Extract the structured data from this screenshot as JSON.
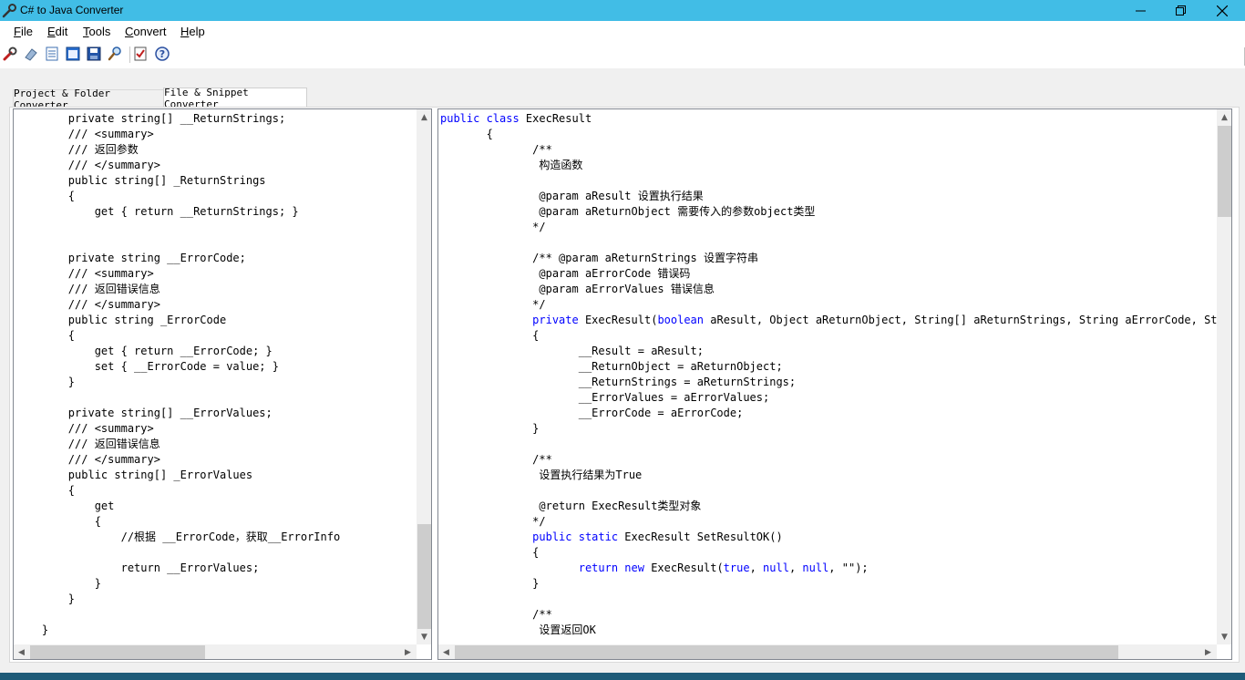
{
  "window": {
    "title": "C# to Java Converter"
  },
  "menu": [
    {
      "key": "F",
      "rest": "ile"
    },
    {
      "key": "E",
      "rest": "dit"
    },
    {
      "key": "T",
      "rest": "ools"
    },
    {
      "key": "C",
      "rest": "onvert"
    },
    {
      "key": "H",
      "rest": "elp"
    }
  ],
  "toolbar": {
    "icons": [
      "wrench-icon",
      "eraser-icon",
      "open-file-icon",
      "window-icon",
      "save-icon",
      "find-icon",
      "checklist-icon",
      "help-icon"
    ]
  },
  "tabs": [
    {
      "label": "Project & Folder Converter",
      "active": false
    },
    {
      "label": "File & Snippet Converter",
      "active": true
    }
  ],
  "left_code": [
    "        private string[] __ReturnStrings;",
    "        /// <summary>",
    "        /// 返回参数",
    "        /// </summary>",
    "        public string[] _ReturnStrings",
    "        {",
    "            get { return __ReturnStrings; }",
    "",
    "",
    "        private string __ErrorCode;",
    "        /// <summary>",
    "        /// 返回错误信息",
    "        /// </summary>",
    "        public string _ErrorCode",
    "        {",
    "            get { return __ErrorCode; }",
    "            set { __ErrorCode = value; }",
    "        }",
    "",
    "        private string[] __ErrorValues;",
    "        /// <summary>",
    "        /// 返回错误信息",
    "        /// </summary>",
    "        public string[] _ErrorValues",
    "        {",
    "            get",
    "            {",
    "                //根据 __ErrorCode，获取__ErrorInfo",
    "",
    "                return __ErrorValues;",
    "            }",
    "        }",
    "",
    "    }"
  ],
  "right_code": [
    [
      {
        "t": "public class",
        "k": true
      },
      {
        "t": " ExecResult"
      }
    ],
    [
      {
        "t": "       {"
      }
    ],
    [
      {
        "t": "              /**"
      }
    ],
    [
      {
        "t": "               构造函数"
      }
    ],
    [
      {
        "t": ""
      }
    ],
    [
      {
        "t": "               @param aResult 设置执行结果"
      }
    ],
    [
      {
        "t": "               @param aReturnObject 需要传入的参数object类型"
      }
    ],
    [
      {
        "t": "              */"
      }
    ],
    [
      {
        "t": ""
      }
    ],
    [
      {
        "t": "              /** @param aReturnStrings 设置字符串"
      }
    ],
    [
      {
        "t": "               @param aErrorCode 错误码"
      }
    ],
    [
      {
        "t": "               @param aErrorValues 错误信息"
      }
    ],
    [
      {
        "t": "              */"
      }
    ],
    [
      {
        "t": "              "
      },
      {
        "t": "private",
        "k": true
      },
      {
        "t": " ExecResult("
      },
      {
        "t": "boolean",
        "k": true
      },
      {
        "t": " aResult, Object aReturnObject, String[] aReturnStrings, String aErrorCode, String"
      }
    ],
    [
      {
        "t": "              {"
      }
    ],
    [
      {
        "t": "                     __Result = aResult;"
      }
    ],
    [
      {
        "t": "                     __ReturnObject = aReturnObject;"
      }
    ],
    [
      {
        "t": "                     __ReturnStrings = aReturnStrings;"
      }
    ],
    [
      {
        "t": "                     __ErrorValues = aErrorValues;"
      }
    ],
    [
      {
        "t": "                     __ErrorCode = aErrorCode;"
      }
    ],
    [
      {
        "t": "              }"
      }
    ],
    [
      {
        "t": ""
      }
    ],
    [
      {
        "t": "              /**"
      }
    ],
    [
      {
        "t": "               设置执行结果为True"
      }
    ],
    [
      {
        "t": ""
      }
    ],
    [
      {
        "t": "               @return ExecResult类型对象"
      }
    ],
    [
      {
        "t": "              */"
      }
    ],
    [
      {
        "t": "              "
      },
      {
        "t": "public static",
        "k": true
      },
      {
        "t": " ExecResult SetResultOK()"
      }
    ],
    [
      {
        "t": "              {"
      }
    ],
    [
      {
        "t": "                     "
      },
      {
        "t": "return new",
        "k": true
      },
      {
        "t": " ExecResult("
      },
      {
        "t": "true",
        "k": true
      },
      {
        "t": ", "
      },
      {
        "t": "null",
        "k": true
      },
      {
        "t": ", "
      },
      {
        "t": "null",
        "k": true
      },
      {
        "t": ", \"\");"
      }
    ],
    [
      {
        "t": "              }"
      }
    ],
    [
      {
        "t": ""
      }
    ],
    [
      {
        "t": "              /**"
      }
    ],
    [
      {
        "t": "               设置返回OK"
      }
    ]
  ],
  "colors": {
    "titlebar": "#41bde6",
    "keyword": "#0000ff",
    "taskbar": "#1e5b78"
  }
}
